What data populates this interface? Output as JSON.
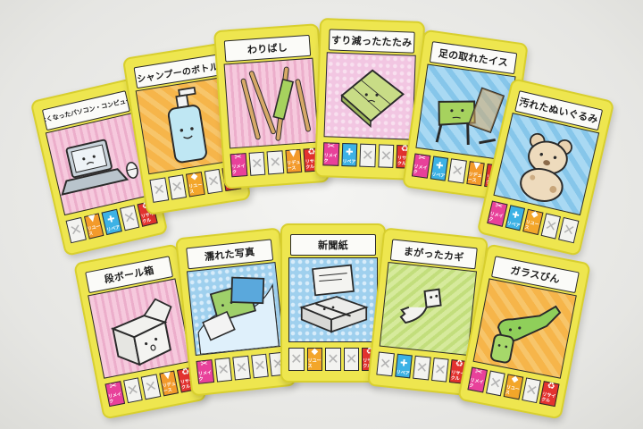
{
  "image": {
    "background": "#e8e8e5",
    "card_color": "#eee64f"
  },
  "cards": [
    {
      "title": "動かなくなったパソコン・コンピューター",
      "art": "laptop-with-mouse",
      "bg": "pink",
      "icons": [
        {
          "kind": "x"
        },
        {
          "kind": "reduce",
          "label": "リユース"
        },
        {
          "kind": "repair",
          "label": "リペア"
        },
        {
          "kind": "x"
        },
        {
          "kind": "recycle",
          "label": "リサイクル"
        }
      ]
    },
    {
      "title": "シャンプーのボトル",
      "art": "shampoo-bottle",
      "bg": "orange",
      "icons": [
        {
          "kind": "x"
        },
        {
          "kind": "x"
        },
        {
          "kind": "reuse",
          "label": "リユース"
        },
        {
          "kind": "x"
        },
        {
          "kind": "recycle",
          "label": "リサイクル"
        }
      ]
    },
    {
      "title": "わりばし",
      "art": "chopsticks",
      "bg": "pink",
      "icons": [
        {
          "kind": "remake",
          "label": "リメイク"
        },
        {
          "kind": "x"
        },
        {
          "kind": "x"
        },
        {
          "kind": "reduce",
          "label": "リデュース"
        },
        {
          "kind": "recycle",
          "label": "リサイクル"
        }
      ]
    },
    {
      "title": "すり減ったたたみ",
      "art": "tatami-mat",
      "bg": "lilac",
      "icons": [
        {
          "kind": "remake",
          "label": "リメイク"
        },
        {
          "kind": "repair",
          "label": "リペア"
        },
        {
          "kind": "x"
        },
        {
          "kind": "x"
        },
        {
          "kind": "recycle",
          "label": "リサイクル"
        }
      ]
    },
    {
      "title": "足の取れたイス",
      "art": "broken-chair",
      "bg": "blue",
      "icons": [
        {
          "kind": "remake",
          "label": "リメイク"
        },
        {
          "kind": "repair",
          "label": "リペア"
        },
        {
          "kind": "x"
        },
        {
          "kind": "reduce",
          "label": "リデュース"
        },
        {
          "kind": "recycle",
          "label": "リサイクル"
        }
      ]
    },
    {
      "title": "汚れたぬいぐるみ",
      "art": "stuffed-bear",
      "bg": "blue",
      "icons": [
        {
          "kind": "remake",
          "label": "リメイク"
        },
        {
          "kind": "repair",
          "label": "リペア"
        },
        {
          "kind": "reuse",
          "label": "リユース"
        },
        {
          "kind": "x"
        },
        {
          "kind": "x"
        }
      ]
    },
    {
      "title": "段ボール箱",
      "art": "cardboard-box",
      "bg": "pink",
      "icons": [
        {
          "kind": "remake",
          "label": "リメイク"
        },
        {
          "kind": "x"
        },
        {
          "kind": "x"
        },
        {
          "kind": "reduce",
          "label": "リデュース"
        },
        {
          "kind": "recycle",
          "label": "リサイクル"
        }
      ]
    },
    {
      "title": "濡れた写真",
      "art": "wet-photos",
      "bg": "dots",
      "icons": [
        {
          "kind": "remake",
          "label": "リメイク"
        },
        {
          "kind": "x"
        },
        {
          "kind": "x"
        },
        {
          "kind": "x"
        },
        {
          "kind": "x"
        }
      ]
    },
    {
      "title": "新聞紙",
      "art": "newspapers",
      "bg": "dots",
      "icons": [
        {
          "kind": "x"
        },
        {
          "kind": "reuse",
          "label": "リユース"
        },
        {
          "kind": "x"
        },
        {
          "kind": "x"
        },
        {
          "kind": "recycle",
          "label": "リサイクル"
        }
      ]
    },
    {
      "title": "まがったカギ",
      "art": "bent-key",
      "bg": "green",
      "icons": [
        {
          "kind": "x"
        },
        {
          "kind": "repair",
          "label": "リペア"
        },
        {
          "kind": "x"
        },
        {
          "kind": "x"
        },
        {
          "kind": "recycle",
          "label": "リサイクル"
        }
      ]
    },
    {
      "title": "ガラスびん",
      "art": "glass-bottles",
      "bg": "orange",
      "icons": [
        {
          "kind": "remake",
          "label": "リメイク"
        },
        {
          "kind": "x"
        },
        {
          "kind": "reuse",
          "label": "リユース"
        },
        {
          "kind": "x"
        },
        {
          "kind": "recycle",
          "label": "リサイクル"
        }
      ]
    }
  ]
}
